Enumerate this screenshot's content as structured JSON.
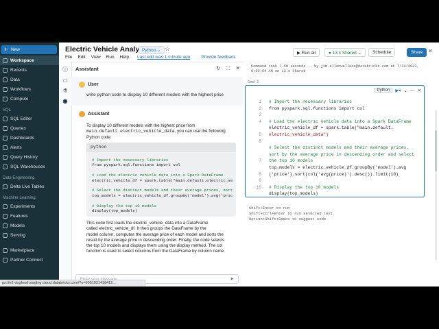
{
  "sidebar": {
    "new_label": "New",
    "main_items": [
      "Workspace",
      "Recents",
      "Data",
      "Workflows",
      "Compute"
    ],
    "sql_section": "SQL",
    "sql_items": [
      "SQL Editor",
      "Queries",
      "Dashboards",
      "Alerts",
      "Query History",
      "SQL Warehouses"
    ],
    "de_section": "Data Engineering",
    "de_items": [
      "Delta Live Tables"
    ],
    "ml_section": "Machine Learning",
    "ml_items": [
      "Experiments",
      "Features",
      "Models",
      "Serving"
    ],
    "bottom_items": [
      "Marketplace",
      "Partner Connect"
    ],
    "status_url": "ps://e2-dogfood.staging.cloud.databricks.com/?o=6051921418412..."
  },
  "header": {
    "title": "Electric Vehicle Analysis",
    "language": "Python ⌄",
    "menu": [
      "File",
      "Edit",
      "View",
      "Run",
      "Help"
    ],
    "last_edit": "Last edit was 1 minute ago",
    "feedback": "Provide feedback",
    "run_all": "▶ Run all",
    "cluster": "● 13.x Shared ⌄",
    "schedule": "Schedule",
    "share": "Share"
  },
  "assistant": {
    "title": "Assistant",
    "user_name": "User",
    "user_message": "write python code to display 10 different models with the highest price",
    "assistant_name": "Assistant",
    "intro_1": "To display 10 different models with the highest price from",
    "intro_2": "main.default.electric_vehicle_data",
    "intro_3": ", you can use the following Python code:",
    "code_lang": "python",
    "code_lines": [
      "# Import the necessary libraries",
      "from pyspark.sql.functions import col",
      "",
      "# Load the electric vehicle data into a Spark DataFrame",
      "electric_vehicle_df = spark.table(\"main.default.electric_ve",
      "",
      "# Select the distinct models and their average prices, sort",
      "top_models = electric_vehicle_df.groupBy('model').avg('pric",
      "",
      "# Display the top 10 models",
      "display(top_models)"
    ],
    "explanation": [
      "This code first loads the electric_vehicle_data into a DataFrame",
      "called electric_vehicle_df. It then groups the DataFrame by the",
      "model column, computes the average price of each model and sorts the",
      "result by the average price in descending order. Finally, the code selects",
      "the top 10 models and displays them using the display method. The col",
      "function is used to select columns from the DataFrame by column name."
    ],
    "input_placeholder": "Enter your message..."
  },
  "notebook": {
    "prev_output_1": "Command took 7.58 seconds -- by jim.allenwallace@databricks.com at 7/24/2023,",
    "prev_output_2": "9:03:54 AM on 13.x Shared",
    "cmd_label": "Cmd 2",
    "cell_lang": "Python",
    "line_numbers": [
      "1",
      "2",
      "3",
      "4",
      "5",
      "6",
      "7",
      "8",
      "9",
      "10",
      "11"
    ],
    "code_lines": [
      "# Import the necessary libraries",
      "from pyspark.sql.functions import col",
      "",
      "# Load the electric vehicle data into a Spark DataFrame",
      "electric_vehicle_df = spark.table(\"main.default.",
      "electric_vehicle_data\")",
      "",
      "# Select the distinct models and their average prices,",
      "sort by the average price in descending order and select",
      "the top 10 models",
      "top_models = electric_vehicle_df.groupBy('model').avg",
      "('price').sort(col('avg(price)').desc()).limit(10)",
      "",
      "# Display the top 10 models",
      "display(top_models)"
    ],
    "hints": [
      "Shift+Enter to run",
      "Shift+Ctrl+Enter to run selected text",
      "Option+Shift+Space to suggest code"
    ]
  }
}
